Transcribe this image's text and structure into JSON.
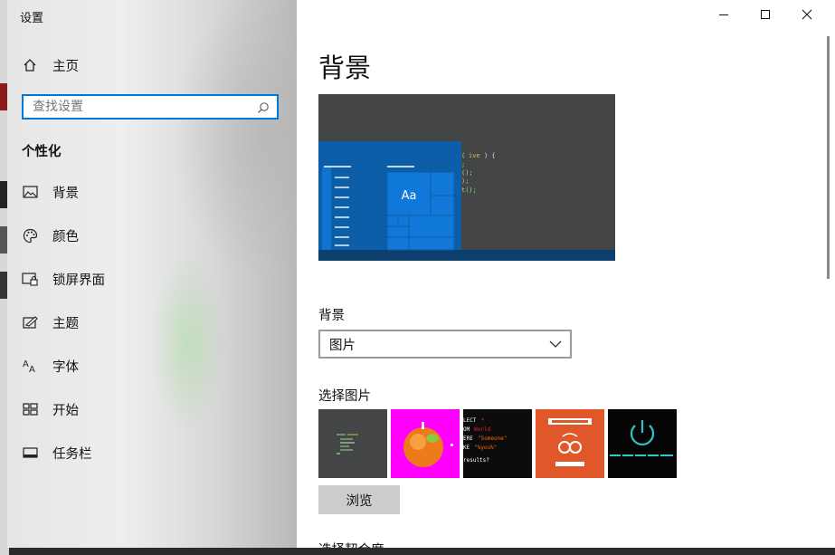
{
  "window": {
    "title": "设置"
  },
  "sidebar": {
    "home_label": "主页",
    "search": {
      "placeholder": "查找设置",
      "value": ""
    },
    "section_title": "个性化",
    "items": [
      {
        "label": "背景",
        "icon": "picture-icon"
      },
      {
        "label": "颜色",
        "icon": "palette-icon"
      },
      {
        "label": "锁屏界面",
        "icon": "lock-screen-icon"
      },
      {
        "label": "主题",
        "icon": "theme-icon"
      },
      {
        "label": "字体",
        "icon": "font-icon"
      },
      {
        "label": "开始",
        "icon": "start-icon"
      },
      {
        "label": "任务栏",
        "icon": "taskbar-icon"
      }
    ]
  },
  "main": {
    "title": "背景",
    "preview": {
      "tile_text": "Aa"
    },
    "background_label": "背景",
    "background_select": {
      "value": "图片"
    },
    "choose_picture_label": "选择图片",
    "browse_label": "浏览",
    "next_label": "选择契合度"
  },
  "colors": {
    "accent": "#0078d7",
    "preview_bg": "#444546",
    "thumb_magenta": "#ff00ff",
    "thumb_orange": "#e0572a"
  }
}
